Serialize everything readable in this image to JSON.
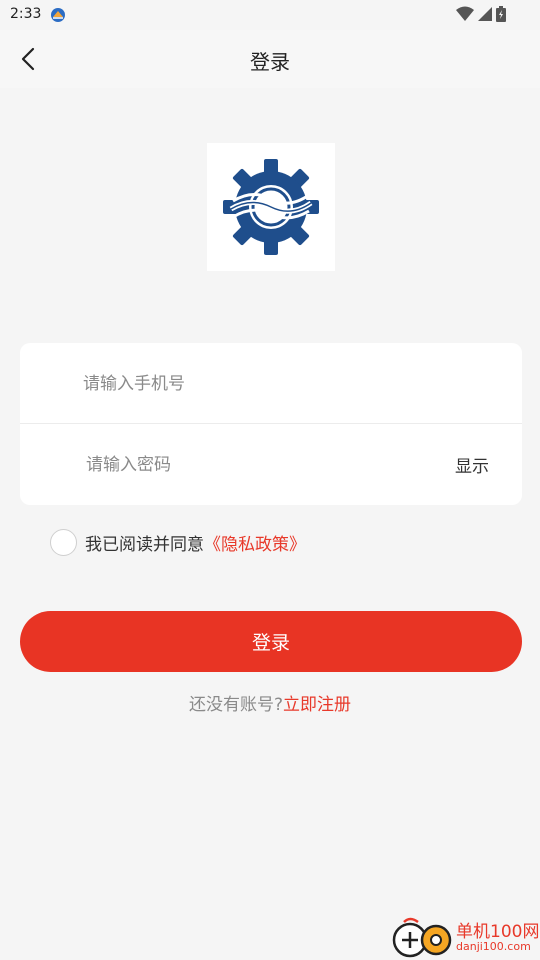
{
  "status_bar": {
    "time": "2:33"
  },
  "header": {
    "title": "登录"
  },
  "form": {
    "phone_placeholder": "请输入手机号",
    "password_placeholder": "请输入密码",
    "show_label": "显示"
  },
  "agreement": {
    "text": "我已阅读并同意",
    "policy_link": "《隐私政策》"
  },
  "login_button": "登录",
  "register": {
    "prompt": "还没有账号?",
    "link": "立即注册"
  },
  "watermark": {
    "text": "单机100网",
    "sub": "danji100.com"
  },
  "colors": {
    "accent": "#e83424",
    "link": "#e8392a",
    "logo_blue": "#1f4e8c",
    "background": "#f5f5f5"
  }
}
